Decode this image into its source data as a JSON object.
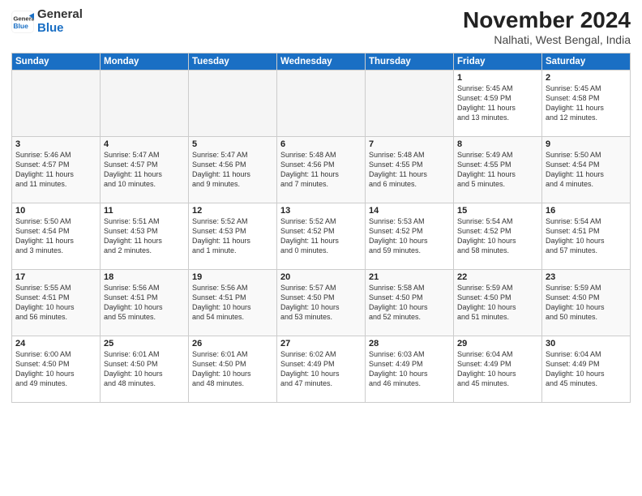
{
  "logo": {
    "general": "General",
    "blue": "Blue"
  },
  "header": {
    "month": "November 2024",
    "location": "Nalhati, West Bengal, India"
  },
  "weekdays": [
    "Sunday",
    "Monday",
    "Tuesday",
    "Wednesday",
    "Thursday",
    "Friday",
    "Saturday"
  ],
  "weeks": [
    [
      {
        "day": "",
        "info": ""
      },
      {
        "day": "",
        "info": ""
      },
      {
        "day": "",
        "info": ""
      },
      {
        "day": "",
        "info": ""
      },
      {
        "day": "",
        "info": ""
      },
      {
        "day": "1",
        "info": "Sunrise: 5:45 AM\nSunset: 4:59 PM\nDaylight: 11 hours\nand 13 minutes."
      },
      {
        "day": "2",
        "info": "Sunrise: 5:45 AM\nSunset: 4:58 PM\nDaylight: 11 hours\nand 12 minutes."
      }
    ],
    [
      {
        "day": "3",
        "info": "Sunrise: 5:46 AM\nSunset: 4:57 PM\nDaylight: 11 hours\nand 11 minutes."
      },
      {
        "day": "4",
        "info": "Sunrise: 5:47 AM\nSunset: 4:57 PM\nDaylight: 11 hours\nand 10 minutes."
      },
      {
        "day": "5",
        "info": "Sunrise: 5:47 AM\nSunset: 4:56 PM\nDaylight: 11 hours\nand 9 minutes."
      },
      {
        "day": "6",
        "info": "Sunrise: 5:48 AM\nSunset: 4:56 PM\nDaylight: 11 hours\nand 7 minutes."
      },
      {
        "day": "7",
        "info": "Sunrise: 5:48 AM\nSunset: 4:55 PM\nDaylight: 11 hours\nand 6 minutes."
      },
      {
        "day": "8",
        "info": "Sunrise: 5:49 AM\nSunset: 4:55 PM\nDaylight: 11 hours\nand 5 minutes."
      },
      {
        "day": "9",
        "info": "Sunrise: 5:50 AM\nSunset: 4:54 PM\nDaylight: 11 hours\nand 4 minutes."
      }
    ],
    [
      {
        "day": "10",
        "info": "Sunrise: 5:50 AM\nSunset: 4:54 PM\nDaylight: 11 hours\nand 3 minutes."
      },
      {
        "day": "11",
        "info": "Sunrise: 5:51 AM\nSunset: 4:53 PM\nDaylight: 11 hours\nand 2 minutes."
      },
      {
        "day": "12",
        "info": "Sunrise: 5:52 AM\nSunset: 4:53 PM\nDaylight: 11 hours\nand 1 minute."
      },
      {
        "day": "13",
        "info": "Sunrise: 5:52 AM\nSunset: 4:52 PM\nDaylight: 11 hours\nand 0 minutes."
      },
      {
        "day": "14",
        "info": "Sunrise: 5:53 AM\nSunset: 4:52 PM\nDaylight: 10 hours\nand 59 minutes."
      },
      {
        "day": "15",
        "info": "Sunrise: 5:54 AM\nSunset: 4:52 PM\nDaylight: 10 hours\nand 58 minutes."
      },
      {
        "day": "16",
        "info": "Sunrise: 5:54 AM\nSunset: 4:51 PM\nDaylight: 10 hours\nand 57 minutes."
      }
    ],
    [
      {
        "day": "17",
        "info": "Sunrise: 5:55 AM\nSunset: 4:51 PM\nDaylight: 10 hours\nand 56 minutes."
      },
      {
        "day": "18",
        "info": "Sunrise: 5:56 AM\nSunset: 4:51 PM\nDaylight: 10 hours\nand 55 minutes."
      },
      {
        "day": "19",
        "info": "Sunrise: 5:56 AM\nSunset: 4:51 PM\nDaylight: 10 hours\nand 54 minutes."
      },
      {
        "day": "20",
        "info": "Sunrise: 5:57 AM\nSunset: 4:50 PM\nDaylight: 10 hours\nand 53 minutes."
      },
      {
        "day": "21",
        "info": "Sunrise: 5:58 AM\nSunset: 4:50 PM\nDaylight: 10 hours\nand 52 minutes."
      },
      {
        "day": "22",
        "info": "Sunrise: 5:59 AM\nSunset: 4:50 PM\nDaylight: 10 hours\nand 51 minutes."
      },
      {
        "day": "23",
        "info": "Sunrise: 5:59 AM\nSunset: 4:50 PM\nDaylight: 10 hours\nand 50 minutes."
      }
    ],
    [
      {
        "day": "24",
        "info": "Sunrise: 6:00 AM\nSunset: 4:50 PM\nDaylight: 10 hours\nand 49 minutes."
      },
      {
        "day": "25",
        "info": "Sunrise: 6:01 AM\nSunset: 4:50 PM\nDaylight: 10 hours\nand 48 minutes."
      },
      {
        "day": "26",
        "info": "Sunrise: 6:01 AM\nSunset: 4:50 PM\nDaylight: 10 hours\nand 48 minutes."
      },
      {
        "day": "27",
        "info": "Sunrise: 6:02 AM\nSunset: 4:49 PM\nDaylight: 10 hours\nand 47 minutes."
      },
      {
        "day": "28",
        "info": "Sunrise: 6:03 AM\nSunset: 4:49 PM\nDaylight: 10 hours\nand 46 minutes."
      },
      {
        "day": "29",
        "info": "Sunrise: 6:04 AM\nSunset: 4:49 PM\nDaylight: 10 hours\nand 45 minutes."
      },
      {
        "day": "30",
        "info": "Sunrise: 6:04 AM\nSunset: 4:49 PM\nDaylight: 10 hours\nand 45 minutes."
      }
    ]
  ]
}
